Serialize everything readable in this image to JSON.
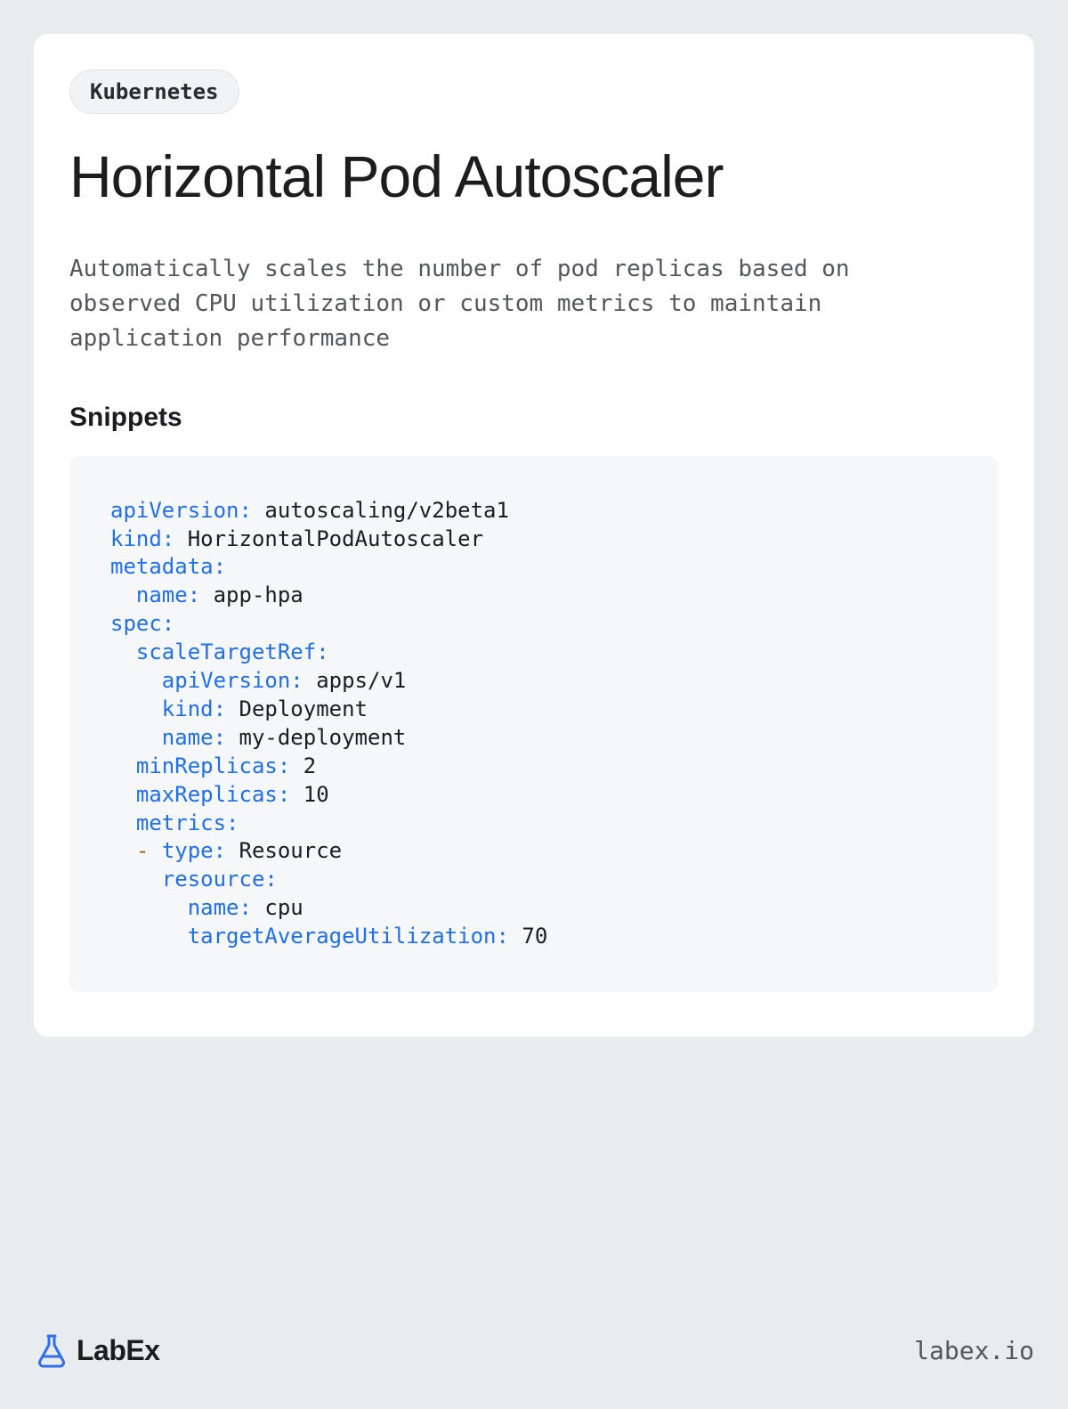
{
  "tag": "Kubernetes",
  "title": "Horizontal Pod Autoscaler",
  "description": "Automatically scales the number of pod replicas based on observed CPU utilization or custom metrics to maintain application performance",
  "snippets_heading": "Snippets",
  "code": {
    "lines": [
      [
        [
          "k",
          "apiVersion:"
        ],
        [
          "v",
          " autoscaling/v2beta1"
        ]
      ],
      [
        [
          "k",
          "kind:"
        ],
        [
          "v",
          " HorizontalPodAutoscaler"
        ]
      ],
      [
        [
          "k",
          "metadata:"
        ]
      ],
      [
        [
          "v",
          "  "
        ],
        [
          "k",
          "name:"
        ],
        [
          "v",
          " app-hpa"
        ]
      ],
      [
        [
          "k",
          "spec:"
        ]
      ],
      [
        [
          "v",
          "  "
        ],
        [
          "k",
          "scaleTargetRef:"
        ]
      ],
      [
        [
          "v",
          "    "
        ],
        [
          "k",
          "apiVersion:"
        ],
        [
          "v",
          " apps/v1"
        ]
      ],
      [
        [
          "v",
          "    "
        ],
        [
          "k",
          "kind:"
        ],
        [
          "v",
          " Deployment"
        ]
      ],
      [
        [
          "v",
          "    "
        ],
        [
          "k",
          "name:"
        ],
        [
          "v",
          " my-deployment"
        ]
      ],
      [
        [
          "v",
          "  "
        ],
        [
          "k",
          "minReplicas:"
        ],
        [
          "v",
          " 2"
        ]
      ],
      [
        [
          "v",
          "  "
        ],
        [
          "k",
          "maxReplicas:"
        ],
        [
          "v",
          " 10"
        ]
      ],
      [
        [
          "v",
          "  "
        ],
        [
          "k",
          "metrics:"
        ]
      ],
      [
        [
          "v",
          "  "
        ],
        [
          "d",
          "-"
        ],
        [
          "v",
          " "
        ],
        [
          "k",
          "type:"
        ],
        [
          "v",
          " Resource"
        ]
      ],
      [
        [
          "v",
          "    "
        ],
        [
          "k",
          "resource:"
        ]
      ],
      [
        [
          "v",
          "      "
        ],
        [
          "k",
          "name:"
        ],
        [
          "v",
          " cpu"
        ]
      ],
      [
        [
          "v",
          "      "
        ],
        [
          "k",
          "targetAverageUtilization:"
        ],
        [
          "v",
          " 70"
        ]
      ]
    ]
  },
  "brand": "LabEx",
  "site": "labex.io"
}
